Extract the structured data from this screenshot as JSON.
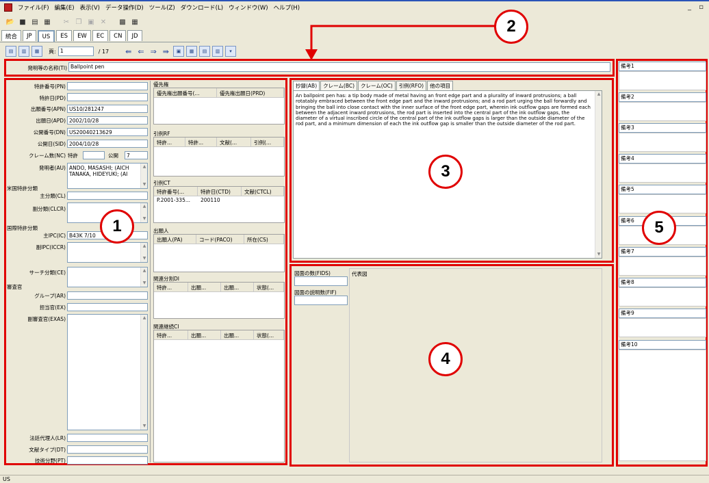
{
  "menu": [
    "ファイル(F)",
    "編集(E)",
    "表示(V)",
    "データ操作(D)",
    "ツール(Z)",
    "ダウンロード(L)",
    "ウィンドウ(W)",
    "ヘルプ(H)"
  ],
  "window_controls": "_ ▫",
  "tabs": [
    "統合",
    "JP",
    "US",
    "ES",
    "EW",
    "EC",
    "CN",
    "JD"
  ],
  "active_tab": "US",
  "pager": {
    "label": "頁:",
    "value": "1",
    "total": "/ 17"
  },
  "title_field": {
    "label": "発明等の名称(TI)",
    "value": "Ballpoint pen"
  },
  "biblio": {
    "pn": {
      "label": "特許番号(PN)",
      "value": ""
    },
    "pd": {
      "label": "特許日(PD)",
      "value": ""
    },
    "apn": {
      "label": "出願番号(APN)",
      "value": "US10/281247"
    },
    "apd": {
      "label": "出願日(APD)",
      "value": "2002/10/28"
    },
    "dn": {
      "label": "公開番号(DN)",
      "value": "US20040213629"
    },
    "sid": {
      "label": "公開日(SID)",
      "value": "2004/10/28"
    },
    "nc": {
      "label": "クレーム数(NC)",
      "patent_label": "特許",
      "patent_value": "",
      "pub_label": "公開",
      "pub_value": "7"
    },
    "au": {
      "label": "発明者(AU)",
      "line1": "ANDO, MASASHI; (AICH",
      "line2": "TANAKA, HIDEYUKI; (AI"
    },
    "us_class_heading": "米国特許分類",
    "cl": {
      "label": "主分類(CL)",
      "value": ""
    },
    "clcr": {
      "label": "副分類(CLCR)",
      "value": ""
    },
    "ipc_heading": "国際特許分類",
    "ic": {
      "label": "主IPC(IC)",
      "value": "B43K  7/10"
    },
    "iccr": {
      "label": "副IPC(ICCR)",
      "value": ""
    },
    "ce": {
      "label": "サーチ分類(CE)",
      "value": ""
    },
    "examiner_heading": "審査官",
    "ar": {
      "label": "グループ(AR)",
      "value": ""
    },
    "ex": {
      "label": "担当官(EX)",
      "value": ""
    },
    "exas": {
      "label": "副審査官(EXAS)",
      "value": ""
    },
    "lr": {
      "label": "法廷代理人(LR)",
      "value": ""
    },
    "dt": {
      "label": "文献タイプ(DT)",
      "value": ""
    },
    "pt": {
      "label": "技術分野(PT)",
      "value": ""
    }
  },
  "priority": {
    "heading": "優先権",
    "cols": [
      "優先権出願番号(...",
      "優先権出願日(PRD)"
    ]
  },
  "rf": {
    "heading": "引例RF",
    "cols": [
      "特許...",
      "特許...",
      "文献(...",
      "引例(..."
    ]
  },
  "ct": {
    "heading": "引例CT",
    "cols": [
      "特許番号(...",
      "特許日(CTD)",
      "文献(CTCL)"
    ],
    "rows": [
      [
        "P.2001-335...",
        "200110",
        ""
      ]
    ]
  },
  "applicant": {
    "heading": "出願人",
    "cols": [
      "出願人(PA)",
      "コード(PACO)",
      "所在(CS)"
    ]
  },
  "di": {
    "heading": "関連分割DI",
    "cols": [
      "特許...",
      "出願...",
      "出願...",
      "状態(..."
    ]
  },
  "ci": {
    "heading": "関連継続CI",
    "cols": [
      "特許...",
      "出願...",
      "出願...",
      "状態(..."
    ]
  },
  "abstract_tabs": [
    "抄録(AB)",
    "クレーム(BC)",
    "クレーム(OC)",
    "引例(RFO)",
    "他の項目"
  ],
  "abstract_text": "An ballpoint pen has: a tip body made of metal having an front edge part and a plurality of inward protrusions; a ball rotatably embraced between the front edge part and the inward protrusions; and a rod part urging the ball forwardly and bringing the ball into close contact with the inner surface of the front edge part, wherein ink outflow gaps are formed each between the adjacent inward protrusions, the rod part is inserted into the central part of the ink outflow gaps, the diameter of a virtual inscribed circle of the central part of the ink outflow gaps is larger than the outside diameter of the rod part, and a minimum dimension of each the ink outflow gap is smaller than the outside diameter of the rod part.",
  "figures": {
    "fids_label": "図面の数(FIDS)",
    "fif_label": "図面の説明数(FIF)",
    "rep_label": "代表図",
    "fids_value": "",
    "fif_value": ""
  },
  "remarks": [
    "備考1",
    "備考2",
    "備考3",
    "備考4",
    "備考5",
    "備考6",
    "備考7",
    "備考8",
    "備考9",
    "備考10"
  ],
  "callouts": [
    "1",
    "2",
    "3",
    "4",
    "5"
  ],
  "status": "US",
  "colors": {
    "highlight": "#e00000",
    "background": "#ece9d8"
  }
}
